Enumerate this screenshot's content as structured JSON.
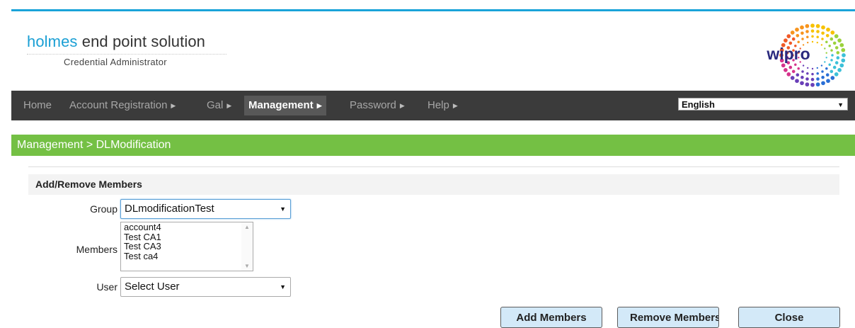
{
  "brand": {
    "title_highlight": "holmes",
    "title_rest": " end point solution",
    "subtitle": "Credential Administrator",
    "logo_text": "wipro"
  },
  "nav": {
    "items": [
      {
        "label": "Home"
      },
      {
        "label": "Account Registration"
      },
      {
        "label": "Gal"
      },
      {
        "label": "Management"
      },
      {
        "label": "Password"
      },
      {
        "label": "Help"
      }
    ],
    "language": "English"
  },
  "breadcrumb": "Management > DLModification",
  "section": {
    "title": "Add/Remove Members"
  },
  "form": {
    "group_label": "Group",
    "group_value": "DLmodificationTest",
    "members_label": "Members",
    "members": [
      "account4",
      "Test CA1",
      "Test CA3",
      "Test ca4"
    ],
    "user_label": "User",
    "user_value": "Select User"
  },
  "buttons": {
    "add": "Add Members",
    "remove": "Remove Members",
    "close": "Close"
  },
  "colors": {
    "accent": "#1aa3d9",
    "navbar": "#3b3b3b",
    "breadcrumb_bar": "#74c044",
    "button_bg": "#d3e9f8"
  }
}
